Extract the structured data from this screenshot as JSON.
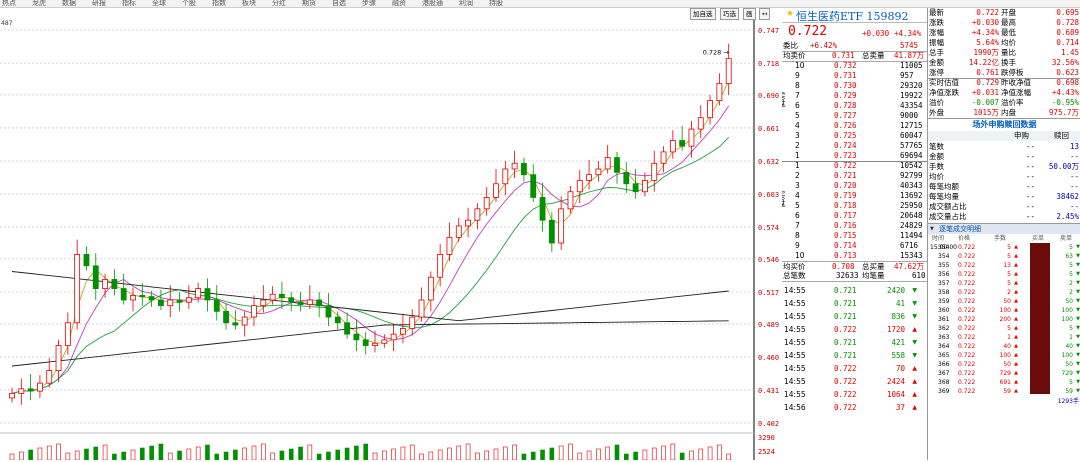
{
  "toolbar": [
    "热点",
    "龙虎",
    "数据",
    "研报",
    "指标",
    "全球",
    "个股",
    "指数",
    "板块",
    "分红",
    "期货",
    "自选",
    "步骤",
    "融资",
    "港股通",
    "利润",
    "持股"
  ],
  "chart_controls": [
    "加自选",
    "巧选",
    "画",
    "↤"
  ],
  "chart_data": {
    "type": "candlestick",
    "ylim": [
      0.402,
      0.747
    ],
    "y_ticks": [
      "0.747",
      "0.718",
      "0.690",
      "0.661",
      "0.632",
      "0.603",
      "0.574",
      "0.546",
      "0.517",
      "0.489",
      "0.460",
      "0.431",
      "0.402"
    ],
    "top_left_label": "487",
    "high_marker": "0.728",
    "volume_ticks": [
      "3290",
      "2524"
    ],
    "ma_colors": [
      "#d0a020",
      "#c040c0",
      "#20a040",
      "#202020"
    ],
    "series": [
      {
        "name": "close",
        "values": [
          0.428,
          0.432,
          0.43,
          0.437,
          0.448,
          0.47,
          0.49,
          0.55,
          0.54,
          0.52,
          0.528,
          0.52,
          0.51,
          0.514,
          0.513,
          0.51,
          0.505,
          0.51,
          0.508,
          0.512,
          0.52,
          0.51,
          0.5,
          0.49,
          0.488,
          0.495,
          0.505,
          0.51,
          0.515,
          0.512,
          0.508,
          0.506,
          0.51,
          0.505,
          0.495,
          0.49,
          0.48,
          0.475,
          0.47,
          0.472,
          0.475,
          0.48,
          0.485,
          0.495,
          0.51,
          0.53,
          0.55,
          0.565,
          0.575,
          0.58,
          0.59,
          0.6,
          0.612,
          0.625,
          0.63,
          0.62,
          0.6,
          0.58,
          0.56,
          0.59,
          0.605,
          0.615,
          0.62,
          0.625,
          0.635,
          0.622,
          0.612,
          0.605,
          0.615,
          0.63,
          0.64,
          0.65,
          0.645,
          0.66,
          0.67,
          0.685,
          0.7,
          0.722
        ]
      }
    ]
  },
  "quote": {
    "title": "恒生医药ETF 159892",
    "price": "0.722",
    "change": "+0.030",
    "change_pct": "+4.34%",
    "commission_ratio_label": "委比",
    "commission_ratio": "+6.42%",
    "commission_diff": "5745",
    "sell_avg_label": "均卖价",
    "sell_avg": "0.731",
    "sell_total_label": "总卖量",
    "sell_total": "41.87万",
    "sell_side_label": "卖盘",
    "buy_side_label": "买盘",
    "asks": [
      {
        "lvl": "10",
        "price": "0.732",
        "vol": "11005"
      },
      {
        "lvl": "9",
        "price": "0.731",
        "vol": "957"
      },
      {
        "lvl": "8",
        "price": "0.730",
        "vol": "29320"
      },
      {
        "lvl": "7",
        "price": "0.729",
        "vol": "19922"
      },
      {
        "lvl": "6",
        "price": "0.728",
        "vol": "43354"
      },
      {
        "lvl": "5",
        "price": "0.727",
        "vol": "9000"
      },
      {
        "lvl": "4",
        "price": "0.726",
        "vol": "12715"
      },
      {
        "lvl": "3",
        "price": "0.725",
        "vol": "60047"
      },
      {
        "lvl": "2",
        "price": "0.724",
        "vol": "57765"
      },
      {
        "lvl": "1",
        "price": "0.723",
        "vol": "69694"
      }
    ],
    "bids": [
      {
        "lvl": "1",
        "price": "0.722",
        "vol": "10542"
      },
      {
        "lvl": "2",
        "price": "0.721",
        "vol": "92799"
      },
      {
        "lvl": "3",
        "price": "0.720",
        "vol": "40343"
      },
      {
        "lvl": "4",
        "price": "0.719",
        "vol": "13692"
      },
      {
        "lvl": "5",
        "price": "0.718",
        "vol": "25950"
      },
      {
        "lvl": "6",
        "price": "0.717",
        "vol": "20648"
      },
      {
        "lvl": "7",
        "price": "0.716",
        "vol": "24829"
      },
      {
        "lvl": "8",
        "price": "0.715",
        "vol": "11494"
      },
      {
        "lvl": "9",
        "price": "0.714",
        "vol": "6716"
      },
      {
        "lvl": "10",
        "price": "0.713",
        "vol": "15343"
      }
    ],
    "buy_avg_label": "均买价",
    "buy_avg": "0.708",
    "buy_total_label": "总买量",
    "buy_total": "47.62万",
    "order_count_label": "总笔数",
    "order_count": "32633",
    "avg_per_order_label": "均笔量",
    "avg_per_order": "610",
    "ticks": [
      {
        "t": "14:55",
        "p": "0.721",
        "v": "2420",
        "d": "down"
      },
      {
        "t": "14:55",
        "p": "0.721",
        "v": "41",
        "d": "down"
      },
      {
        "t": "14:55",
        "p": "0.721",
        "v": "836",
        "d": "down"
      },
      {
        "t": "14:55",
        "p": "0.722",
        "v": "1720",
        "d": "up"
      },
      {
        "t": "14:55",
        "p": "0.721",
        "v": "421",
        "d": "down"
      },
      {
        "t": "14:55",
        "p": "0.721",
        "v": "558",
        "d": "down"
      },
      {
        "t": "14:55",
        "p": "0.722",
        "v": "70",
        "d": "up"
      },
      {
        "t": "14:55",
        "p": "0.722",
        "v": "2424",
        "d": "up"
      },
      {
        "t": "14:55",
        "p": "0.722",
        "v": "1064",
        "d": "up"
      },
      {
        "t": "14:56",
        "p": "0.722",
        "v": "37",
        "d": "up"
      }
    ]
  },
  "stats": {
    "rows": [
      {
        "l1": "最新",
        "v1": "0.722",
        "l2": "开盘",
        "v2": "0.695"
      },
      {
        "l1": "涨跌",
        "v1": "+0.030",
        "l2": "最高",
        "v2": "0.728"
      },
      {
        "l1": "涨幅",
        "v1": "+4.34%",
        "l2": "最低",
        "v2": "0.689"
      },
      {
        "l1": "振幅",
        "v1": "5.64%",
        "l2": "均价",
        "v2": "0.714"
      },
      {
        "l1": "总手",
        "v1": "1990万",
        "l2": "量比",
        "v2": "1.45"
      },
      {
        "l1": "金额",
        "v1": "14.22亿",
        "l2": "换手",
        "v2": "32.56%"
      },
      {
        "l1": "涨停",
        "v1": "0.761",
        "l2": "跌停板",
        "v2": "0.623"
      },
      {
        "l1": "实时估值",
        "v1": "0.729",
        "l2": "昨收净值",
        "v2": "0.698"
      },
      {
        "l1": "净值涨跌",
        "v1": "+0.031",
        "l2": "净值涨幅",
        "v2": "+4.43%"
      },
      {
        "l1": "溢价",
        "v1": "-0.007",
        "l2": "溢价率",
        "v2": "-0.95%"
      },
      {
        "l1": "外盘",
        "v1": "1015万",
        "l2": "内盘",
        "v2": "975.7万"
      }
    ],
    "subscription_title": "场外申购赎回数据",
    "sub_col1": "申购",
    "sub_col2": "赎回",
    "sub_rows": [
      {
        "l": "笔数",
        "a": "--",
        "b": "13"
      },
      {
        "l": "金额",
        "a": "--",
        "b": "--"
      },
      {
        "l": "手数",
        "a": "--",
        "b": "50.00万"
      },
      {
        "l": "均价",
        "a": "--",
        "b": "--"
      },
      {
        "l": "每笔均额",
        "a": "--",
        "b": "--"
      },
      {
        "l": "每笔均量",
        "a": "--",
        "b": "38462"
      },
      {
        "l": "成交额占比",
        "a": "--",
        "b": "--"
      },
      {
        "l": "成交量占比",
        "a": "--",
        "b": "2.45%"
      }
    ],
    "detail_tab": "逐笔成交明细",
    "detail_headers": [
      "时间",
      "价格",
      "手数",
      "买单",
      "卖单"
    ],
    "detail_rows": [
      {
        "t": "15:00:00",
        "n": "354",
        "p": "0.722",
        "v": "5",
        "s": "5"
      },
      {
        "t": "",
        "n": "354",
        "p": "0.722",
        "v": "5",
        "s": "63"
      },
      {
        "t": "",
        "n": "355",
        "p": "0.722",
        "v": "13",
        "s": "5"
      },
      {
        "t": "",
        "n": "356",
        "p": "0.722",
        "v": "5",
        "s": "5"
      },
      {
        "t": "",
        "n": "357",
        "p": "0.722",
        "v": "5",
        "s": "2"
      },
      {
        "t": "",
        "n": "358",
        "p": "0.722",
        "v": "2",
        "s": "2"
      },
      {
        "t": "",
        "n": "359",
        "p": "0.722",
        "v": "50",
        "s": "50"
      },
      {
        "t": "",
        "n": "360",
        "p": "0.722",
        "v": "100",
        "s": "100"
      },
      {
        "t": "",
        "n": "361",
        "p": "0.722",
        "v": "200",
        "s": "100"
      },
      {
        "t": "",
        "n": "362",
        "p": "0.722",
        "v": "5",
        "s": "5"
      },
      {
        "t": "",
        "n": "363",
        "p": "0.722",
        "v": "1",
        "s": "1"
      },
      {
        "t": "",
        "n": "364",
        "p": "0.722",
        "v": "40",
        "s": "40"
      },
      {
        "t": "",
        "n": "365",
        "p": "0.722",
        "v": "100",
        "s": "100"
      },
      {
        "t": "",
        "n": "366",
        "p": "0.722",
        "v": "50",
        "s": "50"
      },
      {
        "t": "",
        "n": "367",
        "p": "0.722",
        "v": "729",
        "s": "729"
      },
      {
        "t": "",
        "n": "368",
        "p": "0.722",
        "v": "691",
        "s": "5"
      },
      {
        "t": "",
        "n": "369",
        "p": "0.722",
        "v": "59",
        "s": "59"
      }
    ],
    "sell_order_volume": "1293手"
  }
}
